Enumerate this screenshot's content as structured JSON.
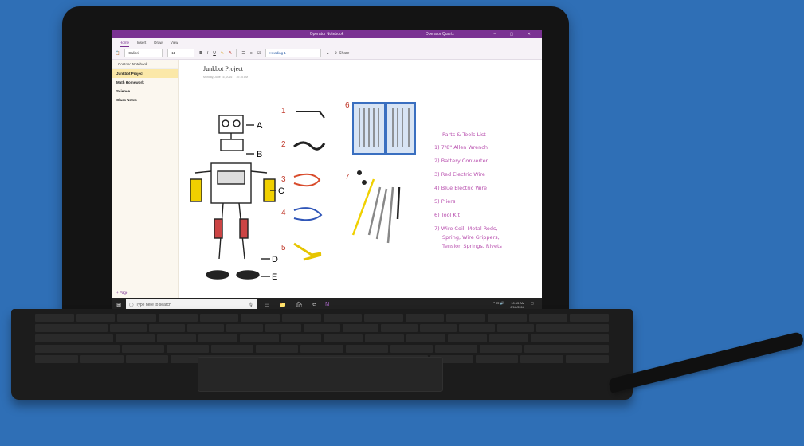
{
  "window": {
    "title": "Operator Notebook",
    "user": "Operator Quartz"
  },
  "menu": {
    "tabs": [
      "Home",
      "Insert",
      "Draw",
      "View"
    ]
  },
  "ribbon": {
    "font": "Calibri",
    "size": "11",
    "style": "Heading 1",
    "share": "Share"
  },
  "nav": {
    "notebook": "Contoso Notebook",
    "sections": [
      "Junkbot Project",
      "Math Homework",
      "Science",
      "Class Notes"
    ],
    "add_page": "+ Page"
  },
  "page": {
    "title": "Junkbot Project",
    "date": "Monday, June 16, 2016",
    "time": "10:15 AM"
  },
  "parts": {
    "heading": "Parts & Tools List",
    "items": [
      "1) 7/8\" Allen Wrench",
      "2) Battery Converter",
      "3) Red Electric Wire",
      "4) Blue Electric Wire",
      "5) Pliers",
      "6) Tool Kit",
      "7) Wire Coil, Metal Rods,",
      "Spring, Wire Grippers,",
      "Tension Springs, Rivets"
    ]
  },
  "figure_labels": [
    "A",
    "B",
    "C",
    "D",
    "E"
  ],
  "tool_numbers": [
    "1",
    "2",
    "3",
    "4",
    "5",
    "6",
    "7"
  ],
  "taskbar": {
    "search_placeholder": "Type here to search",
    "time": "10:15 AM",
    "date": "6/16/2016"
  },
  "colors": {
    "background": "#2f6fb6",
    "onenote_purple": "#7a3292",
    "ink_pink": "#b84fae"
  }
}
